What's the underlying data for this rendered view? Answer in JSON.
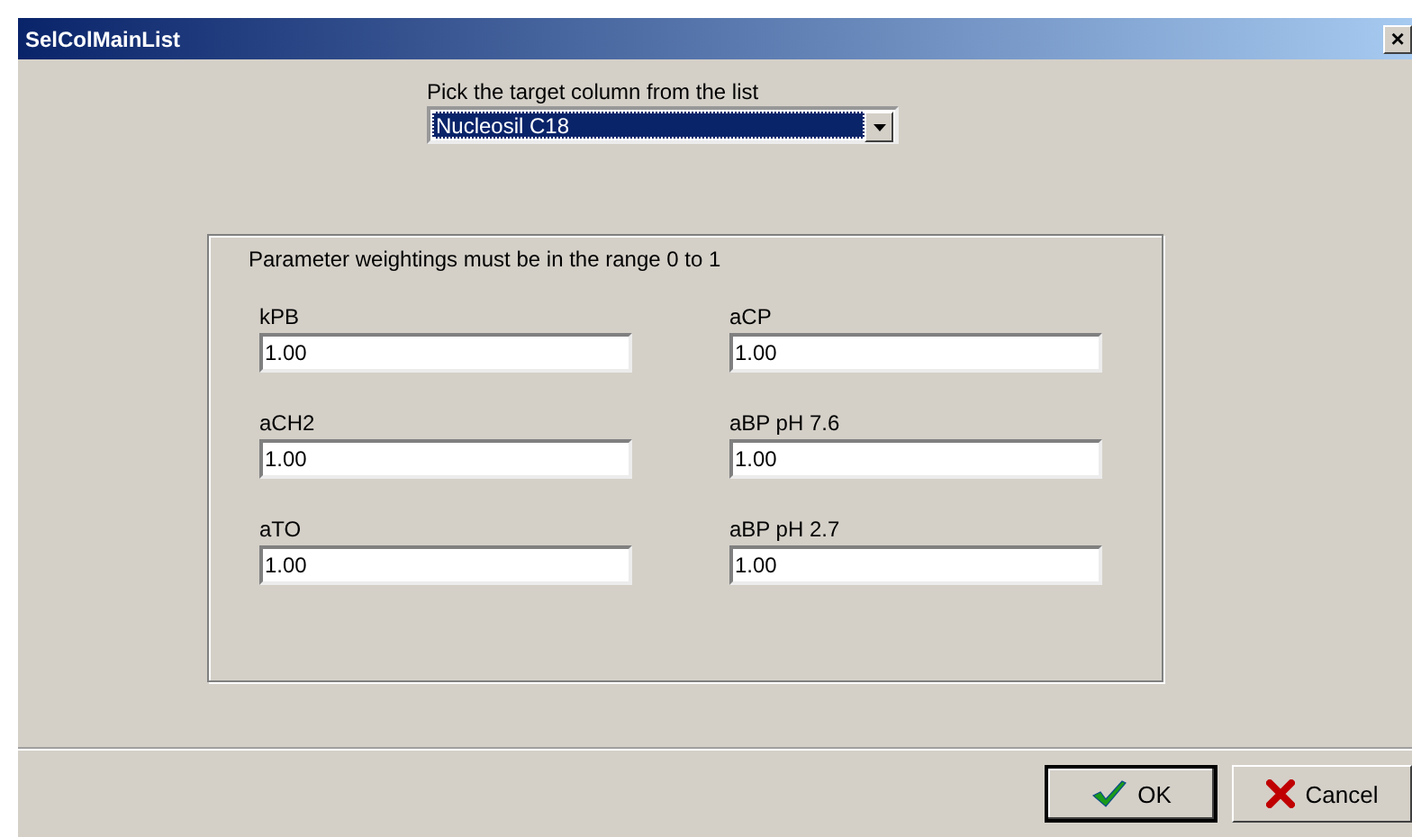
{
  "window": {
    "title": "SelColMainList",
    "close": "×"
  },
  "column_picker": {
    "label": "Pick the target column from the list",
    "value": "Nucleosil C18"
  },
  "weightings": {
    "note": "Parameter weightings must be in the range 0 to 1",
    "fields": [
      {
        "label": "kPB",
        "value": "1.00"
      },
      {
        "label": "aCP",
        "value": "1.00"
      },
      {
        "label": "aCH2",
        "value": "1.00"
      },
      {
        "label": "aBP pH 7.6",
        "value": "1.00"
      },
      {
        "label": "aTO",
        "value": "1.00"
      },
      {
        "label": "aBP pH 2.7",
        "value": "1.00"
      }
    ]
  },
  "buttons": [
    {
      "kind": "ok",
      "label": "OK",
      "default": true
    },
    {
      "kind": "cancel",
      "label": "Cancel",
      "default": false
    }
  ]
}
